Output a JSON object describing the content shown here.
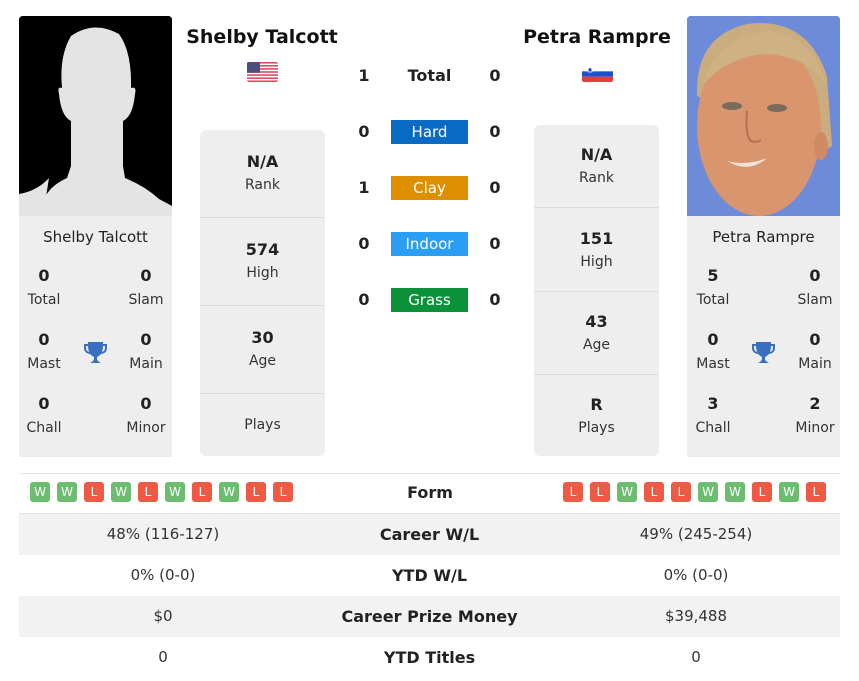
{
  "players": {
    "left": {
      "name": "Shelby Talcott",
      "country_flag": "usa-flag",
      "photo": "silhouette-placeholder",
      "titles": {
        "total": {
          "value": "0",
          "label": "Total"
        },
        "slam": {
          "value": "0",
          "label": "Slam"
        },
        "mast": {
          "value": "0",
          "label": "Mast"
        },
        "main": {
          "value": "0",
          "label": "Main"
        },
        "chall": {
          "value": "0",
          "label": "Chall"
        },
        "minor": {
          "value": "0",
          "label": "Minor"
        }
      },
      "stats": {
        "rank": {
          "value": "N/A",
          "label": "Rank"
        },
        "high": {
          "value": "574",
          "label": "High"
        },
        "age": {
          "value": "30",
          "label": "Age"
        },
        "plays": {
          "value": "",
          "label": "Plays"
        }
      },
      "form": [
        "W",
        "W",
        "L",
        "W",
        "L",
        "W",
        "L",
        "W",
        "L",
        "L"
      ]
    },
    "right": {
      "name": "Petra Rampre",
      "country_flag": "slovenia-flag",
      "photo": "player-headshot",
      "titles": {
        "total": {
          "value": "5",
          "label": "Total"
        },
        "slam": {
          "value": "0",
          "label": "Slam"
        },
        "mast": {
          "value": "0",
          "label": "Mast"
        },
        "main": {
          "value": "0",
          "label": "Main"
        },
        "chall": {
          "value": "3",
          "label": "Chall"
        },
        "minor": {
          "value": "2",
          "label": "Minor"
        }
      },
      "stats": {
        "rank": {
          "value": "N/A",
          "label": "Rank"
        },
        "high": {
          "value": "151",
          "label": "High"
        },
        "age": {
          "value": "43",
          "label": "Age"
        },
        "plays": {
          "value": "R",
          "label": "Plays"
        }
      },
      "form": [
        "L",
        "L",
        "W",
        "L",
        "L",
        "W",
        "W",
        "L",
        "W",
        "L"
      ]
    }
  },
  "h2h": {
    "total": {
      "label": "Total",
      "left": "1",
      "right": "0"
    },
    "surfaces": [
      {
        "label": "Hard",
        "left": "0",
        "right": "0",
        "color": "#0a6bc4"
      },
      {
        "label": "Clay",
        "left": "1",
        "right": "0",
        "color": "#de8f00"
      },
      {
        "label": "Indoor",
        "left": "0",
        "right": "0",
        "color": "#2a9df4"
      },
      {
        "label": "Grass",
        "left": "0",
        "right": "0",
        "color": "#0b9139"
      }
    ]
  },
  "form_label": "Form",
  "form_colors": {
    "W": "#6cbd70",
    "L": "#ee5b45"
  },
  "comparison": [
    {
      "label": "Career W/L",
      "left": "48% (116-127)",
      "right": "49% (245-254)"
    },
    {
      "label": "YTD W/L",
      "left": "0% (0-0)",
      "right": "0% (0-0)"
    },
    {
      "label": "Career Prize Money",
      "left": "$0",
      "right": "$39,488"
    },
    {
      "label": "YTD Titles",
      "left": "0",
      "right": "0"
    }
  ]
}
